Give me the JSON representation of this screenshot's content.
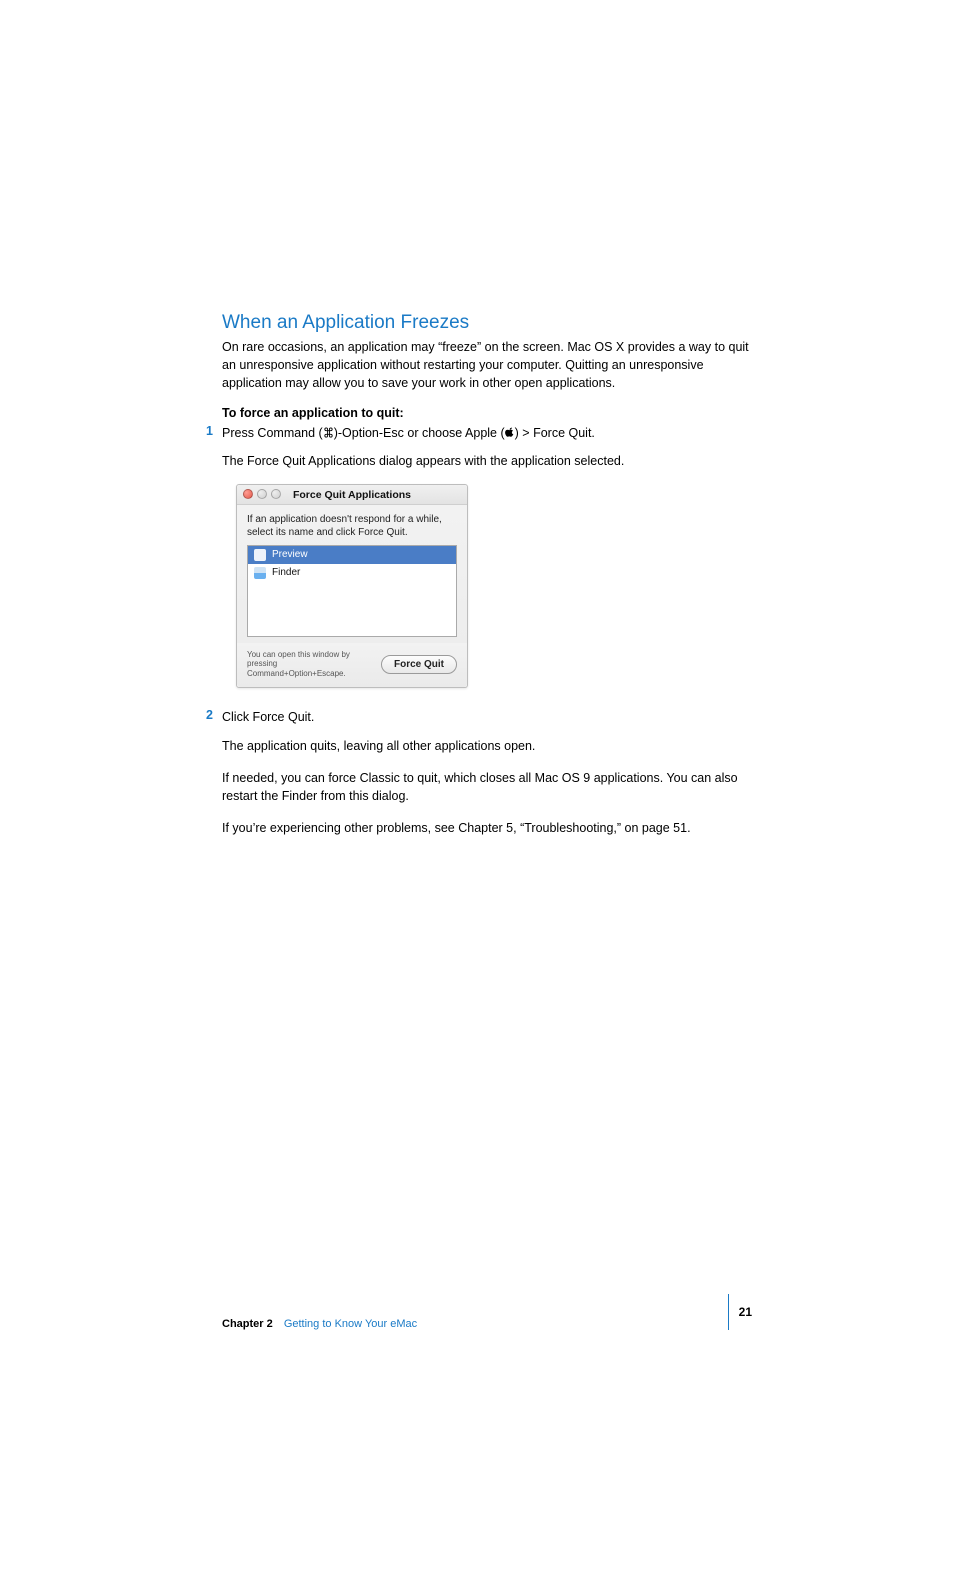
{
  "heading": "When an Application Freezes",
  "intro": "On rare occasions, an application may “freeze” on the screen. Mac OS X provides a way to quit an unresponsive application without restarting your computer. Quitting an unresponsive application may allow you to save your work in other open applications.",
  "subhead": "To force an application to quit:",
  "step1": {
    "num": "1",
    "prefix": "Press Command (",
    "mid1": ")-Option-Esc or choose Apple (",
    "suffix": ") > Force Quit.",
    "caption": "The Force Quit Applications dialog appears with the application selected."
  },
  "dialog": {
    "title": "Force Quit Applications",
    "body": "If an application doesn't respond for a while, select its name and click Force Quit.",
    "apps": {
      "preview": "Preview",
      "finder": "Finder"
    },
    "hint": "You can open this window by pressing Command+Option+Escape.",
    "button": "Force Quit"
  },
  "step2": {
    "num": "2",
    "text": "Click Force Quit.",
    "p1": "The application quits, leaving all other applications open.",
    "p2": "If needed, you can force Classic to quit, which closes all Mac OS 9 applications. You can also restart the Finder from this dialog.",
    "p3": "If you’re experiencing other problems, see Chapter 5, “Troubleshooting,” on page 51."
  },
  "footer": {
    "chapter_label": "Chapter 2",
    "chapter_title": "Getting to Know Your eMac",
    "page_num": "21"
  }
}
